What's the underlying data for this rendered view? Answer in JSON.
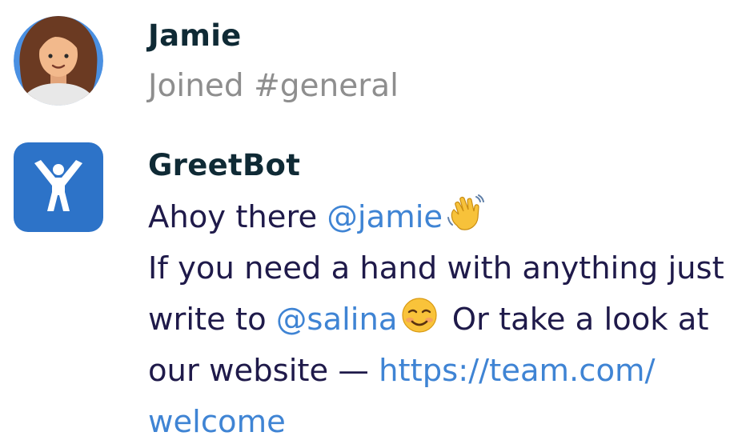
{
  "messages": {
    "jamie": {
      "author": "Jamie",
      "text": "Joined #general",
      "avatar_icon": "woman-avatar-icon"
    },
    "greetbot": {
      "author": "GreetBot",
      "avatar_icon": "greetbot-logo-icon",
      "avatar_color": "#2d73c8",
      "line1_text": "Ahoy there ",
      "mention1": "@jamie",
      "emoji1": "waving-hand-emoji",
      "line2_text": "If you need a hand with anything just",
      "line3_prefix": "write to ",
      "mention2": "@salina",
      "emoji2": "smiling-face-emoji",
      "line3_suffix": " Or take a look at",
      "line4_prefix": "our website — ",
      "link_part1": "https://team.com/",
      "link_part2": "welcome"
    }
  },
  "colors": {
    "author": "#0f2a35",
    "body": "#1f1a4a",
    "muted": "#8e8e8e",
    "mention": "#3f84d4"
  }
}
